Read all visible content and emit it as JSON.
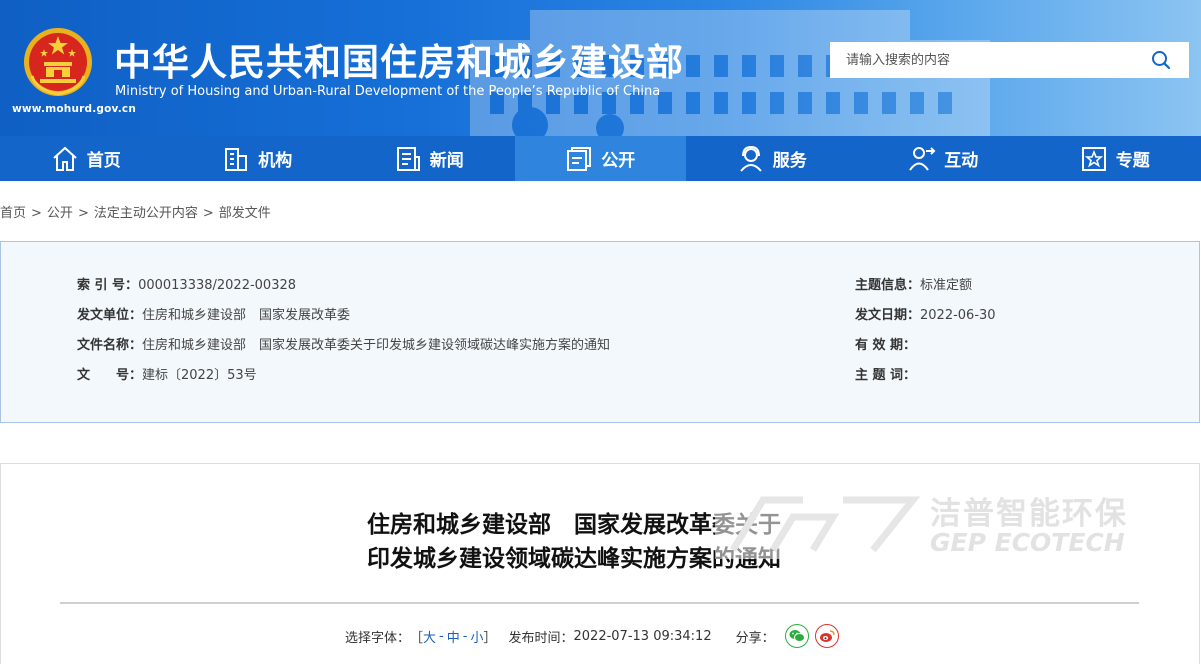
{
  "header": {
    "title": "中华人民共和国住房和城乡建设部",
    "subtitle": "Ministry of Housing and Urban-Rural Development of the People’s Republic of China",
    "url": "www.mohurd.gov.cn"
  },
  "search": {
    "placeholder": "请输入搜索的内容"
  },
  "nav": {
    "items": [
      {
        "label": "首页"
      },
      {
        "label": "机构"
      },
      {
        "label": "新闻"
      },
      {
        "label": "公开"
      },
      {
        "label": "服务"
      },
      {
        "label": "互动"
      },
      {
        "label": "专题"
      }
    ],
    "active_index": 3
  },
  "breadcrumb": {
    "items": [
      "首页",
      "公开",
      "法定主动公开内容",
      "部发文件"
    ],
    "separator": ">"
  },
  "meta": {
    "index_label": "索 引 号：",
    "index_value": "000013338/2022-00328",
    "issuer_label": "发文单位：",
    "issuer_value": "住房和城乡建设部　国家发展改革委",
    "filename_label": "文件名称：",
    "filename_value": "住房和城乡建设部　国家发展改革委关于印发城乡建设领域碳达峰实施方案的通知",
    "docno_label": "文　　号：",
    "docno_value": "建标〔2022〕53号",
    "topic_label": "主题信息：",
    "topic_value": "标准定额",
    "date_label": "发文日期：",
    "date_value": "2022-06-30",
    "validity_label": "有 效 期：",
    "validity_value": "",
    "keywords_label": "主 题 词：",
    "keywords_value": ""
  },
  "article": {
    "title_line1": "住房和城乡建设部　国家发展改革委关于",
    "title_line2": "印发城乡建设领域碳达峰实施方案的通知",
    "font_label": "选择字体：",
    "font_open": "［",
    "font_large": "大",
    "font_medium": "中",
    "font_small": "小",
    "font_sep": "-",
    "font_close": "］",
    "publish_label": "发布时间：",
    "publish_value": "2022-07-13 09:34:12",
    "share_label": "分享："
  },
  "watermark": {
    "cn": "洁普智能环保",
    "en": "GEP ECOTECH"
  },
  "colors": {
    "header_blue": "#1465c9",
    "nav_active": "#2f85dd",
    "meta_bg": "#f3f8fd",
    "link": "#1a5fbf",
    "wechat": "#2aae3b",
    "weibo": "#d9332c"
  }
}
